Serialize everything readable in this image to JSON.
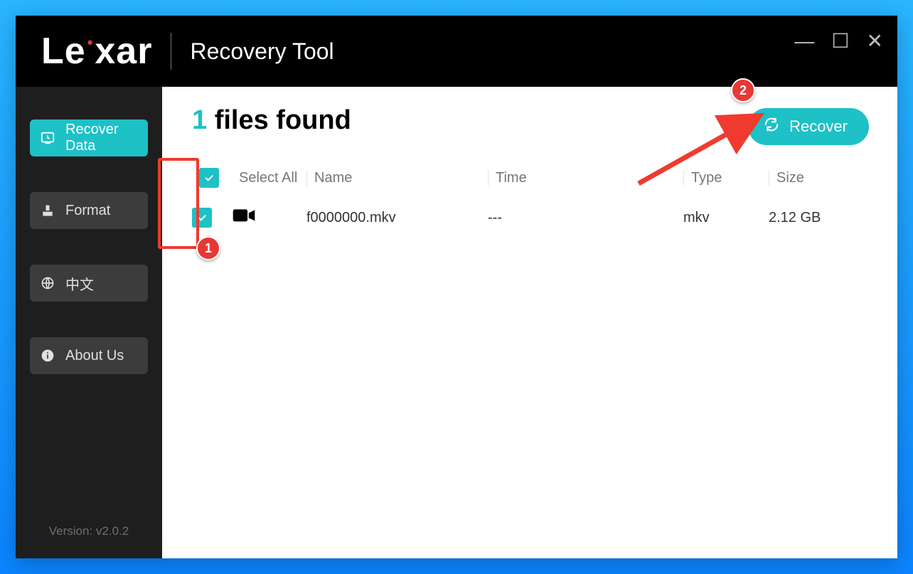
{
  "app": {
    "brand": "Lexar",
    "title": "Recovery Tool"
  },
  "sidebar": {
    "items": [
      {
        "label": "Recover Data",
        "icon": "recover"
      },
      {
        "label": "Format",
        "icon": "format"
      },
      {
        "label": "中文",
        "icon": "globe"
      },
      {
        "label": "About Us",
        "icon": "info"
      }
    ],
    "version": "Version: v2.0.2"
  },
  "main": {
    "files_count": "1",
    "heading_suffix": "files found",
    "recover_label": "Recover",
    "columns": {
      "select_all": "Select All",
      "name": "Name",
      "time": "Time",
      "type": "Type",
      "size": "Size"
    },
    "rows": [
      {
        "name": "f0000000.mkv",
        "time": "---",
        "type": "mkv",
        "size": "2.12 GB"
      }
    ]
  },
  "annotations": {
    "step1": "1",
    "step2": "2"
  }
}
